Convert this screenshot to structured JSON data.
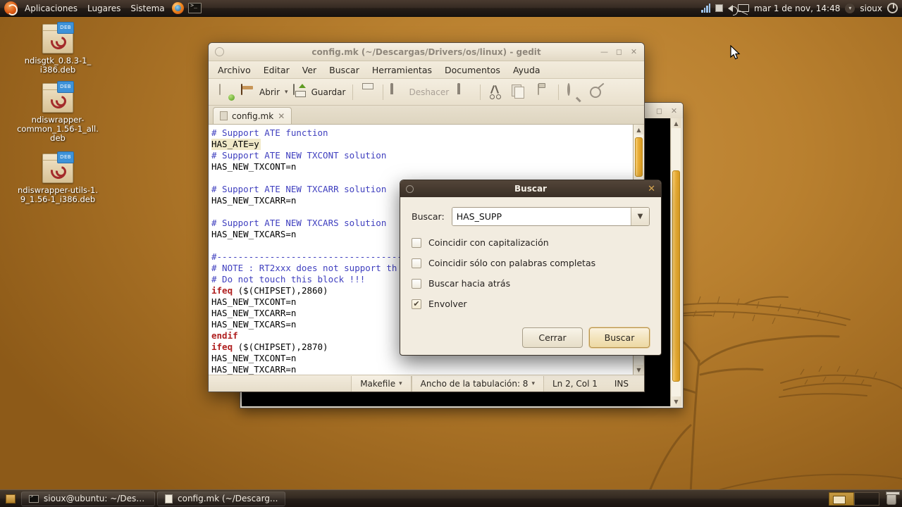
{
  "desktop": {
    "wallpaper_color": "#a66f24",
    "icons": [
      {
        "name": "ndisgtk_0.8.3-1_i386.deb",
        "label": "ndisgtk_0.8.3-1_\ni386.deb",
        "type": "deb-package",
        "badge": "DEB"
      },
      {
        "name": "ndiswrapper-common_1.56-1_all.deb",
        "label": "ndiswrapper-\ncommon_1.56-1_all.\ndeb",
        "type": "deb-package",
        "badge": "DEB"
      },
      {
        "name": "ndiswrapper-utils-1.9_1.56-1_i386.deb",
        "label": "ndiswrapper-utils-1.\n9_1.56-1_i386.deb",
        "type": "deb-package",
        "badge": "DEB"
      }
    ]
  },
  "top_panel": {
    "menus": [
      {
        "label": "Aplicaciones"
      },
      {
        "label": "Lugares"
      },
      {
        "label": "Sistema"
      }
    ],
    "launchers": [
      {
        "icon": "firefox-icon",
        "title": "Firefox"
      },
      {
        "icon": "terminal-icon",
        "title": "Terminal"
      }
    ],
    "tray": {
      "signal_icon": "network-signal-icon",
      "update_icon": "update-manager-icon",
      "volume_icon": "volume-icon",
      "mail_icon": "mail-icon",
      "clock": "mar  1 de nov, 14:48",
      "user": "sioux",
      "power_icon": "power-icon"
    }
  },
  "gedit": {
    "title": "config.mk (~/Descargas/Drivers/os/linux) - gedit",
    "menubar": [
      {
        "label": "Archivo",
        "mnemonic": "A"
      },
      {
        "label": "Editar",
        "mnemonic": "E"
      },
      {
        "label": "Ver",
        "mnemonic": "V"
      },
      {
        "label": "Buscar",
        "mnemonic": "B"
      },
      {
        "label": "Herramientas",
        "mnemonic": "H"
      },
      {
        "label": "Documentos",
        "mnemonic": "D"
      },
      {
        "label": "Ayuda",
        "mnemonic": "y"
      }
    ],
    "toolbar": {
      "new_label": "",
      "open_label": "Abrir",
      "save_label": "Guardar",
      "print_label": "",
      "undo_label": "Deshacer",
      "redo_label": ""
    },
    "tab": {
      "label": "config.mk",
      "close": "✕"
    },
    "code_lines": [
      {
        "text": "# Support ATE function",
        "style": "comment"
      },
      {
        "text": "HAS_ATE=y",
        "style": "current"
      },
      {
        "text": "# Support ATE NEW TXCONT solution",
        "style": "comment"
      },
      {
        "text": "HAS_NEW_TXCONT=n",
        "style": "plain"
      },
      {
        "text": "",
        "style": "plain"
      },
      {
        "text": "# Support ATE NEW TXCARR solution",
        "style": "comment"
      },
      {
        "text": "HAS_NEW_TXCARR=n",
        "style": "plain"
      },
      {
        "text": "",
        "style": "plain"
      },
      {
        "text": "# Support ATE NEW TXCARS solution",
        "style": "comment"
      },
      {
        "text": "HAS_NEW_TXCARS=n",
        "style": "plain"
      },
      {
        "text": "",
        "style": "plain"
      },
      {
        "text": "#-----------------------------------",
        "style": "comment"
      },
      {
        "text": "# NOTE : RT2xxx does not support th",
        "style": "comment"
      },
      {
        "text": "# Do not touch this block !!!",
        "style": "comment"
      },
      {
        "text": "ifeq ($(CHIPSET),2860)",
        "style": "keyword"
      },
      {
        "text": "HAS_NEW_TXCONT=n",
        "style": "plain"
      },
      {
        "text": "HAS_NEW_TXCARR=n",
        "style": "plain"
      },
      {
        "text": "HAS_NEW_TXCARS=n",
        "style": "plain"
      },
      {
        "text": "endif",
        "style": "keyword"
      },
      {
        "text": "ifeq ($(CHIPSET),2870)",
        "style": "keyword"
      },
      {
        "text": "HAS_NEW_TXCONT=n",
        "style": "plain"
      },
      {
        "text": "HAS_NEW_TXCARR=n",
        "style": "plain"
      }
    ],
    "statusbar": {
      "language": "Makefile",
      "tab_width": "Ancho de la tabulación: 8",
      "position": "Ln 2, Col 1",
      "insert_mode": "INS"
    },
    "window_buttons": {
      "minimize": "—",
      "maximize": "◻",
      "close": "✕"
    }
  },
  "terminal": {
    "window_buttons": {
      "maximize": "◻",
      "close": "✕"
    },
    "content": ""
  },
  "find_dialog": {
    "title": "Buscar",
    "close": "✕",
    "search_label": "Buscar:",
    "search_value": "HAS_SUPP",
    "search_placeholder": "",
    "dropdown_icon": "chevron-down-icon",
    "options": [
      {
        "label": "Coincidir con capitalización",
        "checked": false
      },
      {
        "label": "Coincidir sólo con palabras completas",
        "checked": false
      },
      {
        "label": "Buscar hacia atrás",
        "checked": false
      },
      {
        "label": "Envolver",
        "checked": true
      }
    ],
    "buttons": {
      "close_label": "Cerrar",
      "find_label": "Buscar"
    }
  },
  "bottom_panel": {
    "show_desktop_icon": "show-desktop-icon",
    "tasks": [
      {
        "label": "sioux@ubuntu: ~/Desc...",
        "icon": "terminal-icon"
      },
      {
        "label": "config.mk (~/Descarg...",
        "icon": "document-icon"
      }
    ],
    "workspaces": [
      {
        "active": true
      },
      {
        "active": false
      }
    ],
    "trash_icon": "trash-icon"
  }
}
